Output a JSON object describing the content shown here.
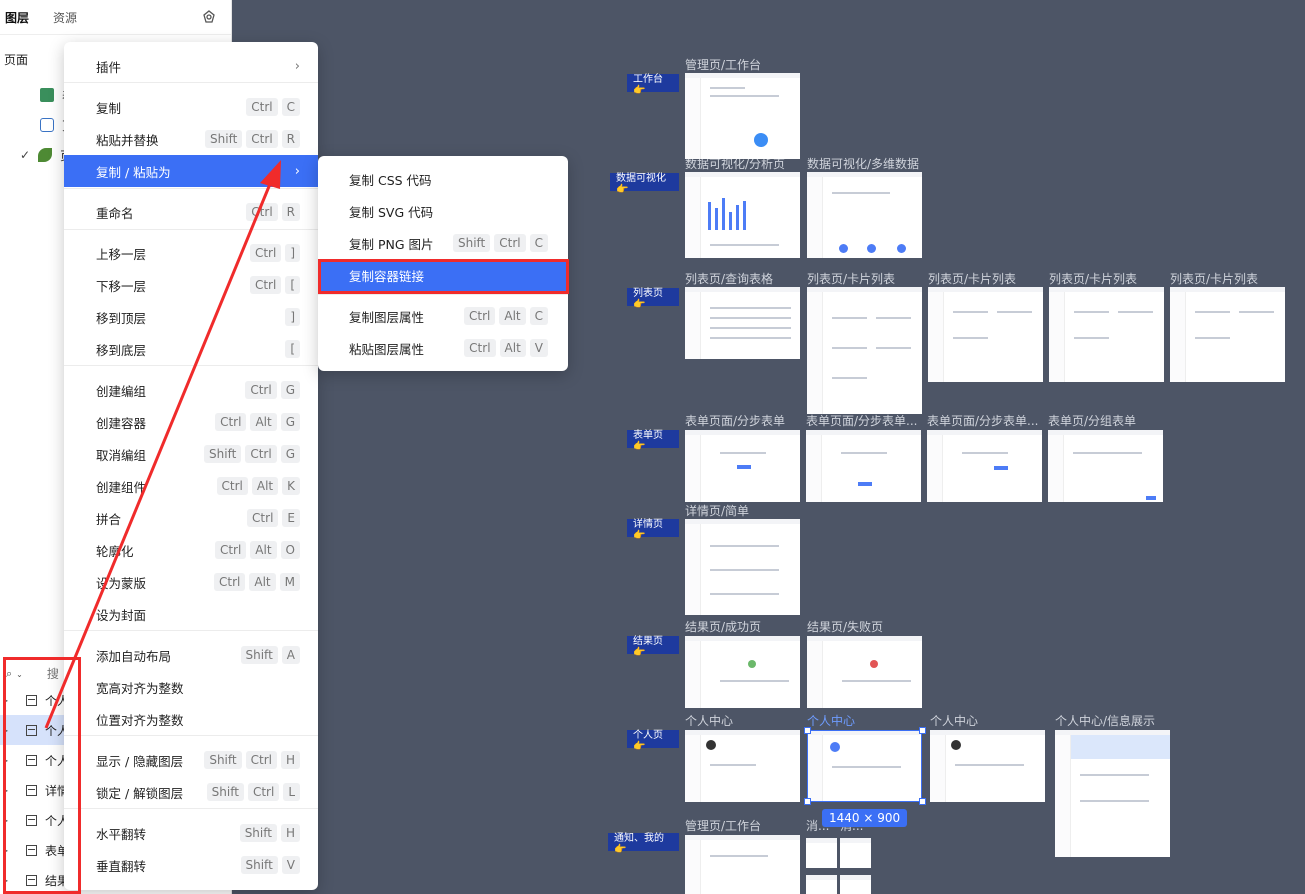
{
  "left_panel": {
    "tab_layers": "图层",
    "tab_assets": "资源",
    "pages_label": "页面",
    "pages": [
      {
        "label": "表"
      },
      {
        "label": "页"
      },
      {
        "label": "页"
      }
    ],
    "search_placeholder": "搜",
    "layers": [
      {
        "label": "个人"
      },
      {
        "label": "个人"
      },
      {
        "label": "个人"
      },
      {
        "label": "详情"
      },
      {
        "label": "个人"
      },
      {
        "label": "表单"
      },
      {
        "label": "结果"
      }
    ]
  },
  "context_menu": {
    "items": [
      {
        "label": "插件",
        "keys": [],
        "submenu": true
      },
      {
        "label": "复制",
        "keys": [
          "Ctrl",
          "C"
        ]
      },
      {
        "label": "粘贴并替换",
        "keys": [
          "Shift",
          "Ctrl",
          "R"
        ]
      },
      {
        "label": "复制 / 粘贴为",
        "keys": [],
        "submenu": true,
        "active": true
      },
      {
        "label": "重命名",
        "keys": [
          "Ctrl",
          "R"
        ]
      },
      {
        "label": "上移一层",
        "keys": [
          "Ctrl",
          "]"
        ]
      },
      {
        "label": "下移一层",
        "keys": [
          "Ctrl",
          "["
        ]
      },
      {
        "label": "移到顶层",
        "keys": [
          "]"
        ]
      },
      {
        "label": "移到底层",
        "keys": [
          "["
        ]
      },
      {
        "label": "创建编组",
        "keys": [
          "Ctrl",
          "G"
        ]
      },
      {
        "label": "创建容器",
        "keys": [
          "Ctrl",
          "Alt",
          "G"
        ]
      },
      {
        "label": "取消编组",
        "keys": [
          "Shift",
          "Ctrl",
          "G"
        ]
      },
      {
        "label": "创建组件",
        "keys": [
          "Ctrl",
          "Alt",
          "K"
        ]
      },
      {
        "label": "拼合",
        "keys": [
          "Ctrl",
          "E"
        ]
      },
      {
        "label": "轮廓化",
        "keys": [
          "Ctrl",
          "Alt",
          "O"
        ]
      },
      {
        "label": "设为蒙版",
        "keys": [
          "Ctrl",
          "Alt",
          "M"
        ]
      },
      {
        "label": "设为封面",
        "keys": []
      },
      {
        "label": "添加自动布局",
        "keys": [
          "Shift",
          "A"
        ]
      },
      {
        "label": "宽高对齐为整数",
        "keys": []
      },
      {
        "label": "位置对齐为整数",
        "keys": []
      },
      {
        "label": "显示 / 隐藏图层",
        "keys": [
          "Shift",
          "Ctrl",
          "H"
        ]
      },
      {
        "label": "锁定 / 解锁图层",
        "keys": [
          "Shift",
          "Ctrl",
          "L"
        ]
      },
      {
        "label": "水平翻转",
        "keys": [
          "Shift",
          "H"
        ]
      },
      {
        "label": "垂直翻转",
        "keys": [
          "Shift",
          "V"
        ]
      }
    ]
  },
  "sub_menu": {
    "items": [
      {
        "label": "复制 CSS 代码",
        "keys": []
      },
      {
        "label": "复制 SVG 代码",
        "keys": []
      },
      {
        "label": "复制 PNG 图片",
        "keys": [
          "Shift",
          "Ctrl",
          "C"
        ]
      },
      {
        "label": "复制容器链接",
        "keys": [],
        "active": true
      },
      {
        "label": "复制图层属性",
        "keys": [
          "Ctrl",
          "Alt",
          "C"
        ]
      },
      {
        "label": "粘贴图层属性",
        "keys": [
          "Ctrl",
          "Alt",
          "V"
        ]
      }
    ]
  },
  "canvas": {
    "section_tags": [
      "工作台👉",
      "数据可视化👉",
      "列表页👉",
      "表单页👉",
      "详情页👉",
      "结果页👉",
      "个人页👉",
      "通知、我的👉"
    ],
    "frame_labels": [
      "管理页/工作台",
      "数据可视化/分析页",
      "数据可视化/多维数据",
      "列表页/查询表格",
      "列表页/卡片列表",
      "列表页/卡片列表",
      "列表页/卡片列表",
      "列表页/卡片列表",
      "表单页面/分步表单",
      "表单页面/分步表单...",
      "表单页面/分步表单...",
      "表单页/分组表单",
      "详情页/简单",
      "结果页/成功页",
      "结果页/失败页",
      "个人中心",
      "个人中心",
      "个人中心",
      "个人中心/信息展示",
      "管理页/工作台",
      "消...",
      "消..."
    ],
    "selected_size": "1440 × 900"
  },
  "colors": {
    "canvas_bg": "#4d5566",
    "accent": "#3b6ff5",
    "annotation_red": "#f02b2b",
    "section_tag": "#1e3a9e"
  }
}
